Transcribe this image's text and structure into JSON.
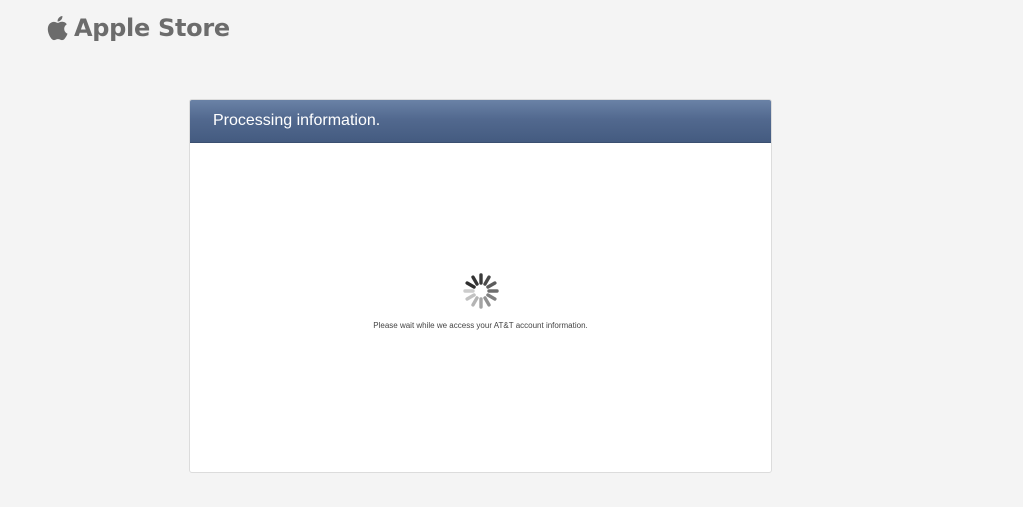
{
  "header": {
    "brand_name": "Apple Store",
    "logo_icon": "apple-logo-icon"
  },
  "panel": {
    "title": "Processing information.",
    "status_message": "Please wait while we access your AT&T account information.",
    "spinner_icon": "loading-spinner-icon"
  },
  "colors": {
    "header_bar": "#52698f",
    "page_background": "#f4f4f4",
    "brand_text": "#6c6c6c"
  }
}
